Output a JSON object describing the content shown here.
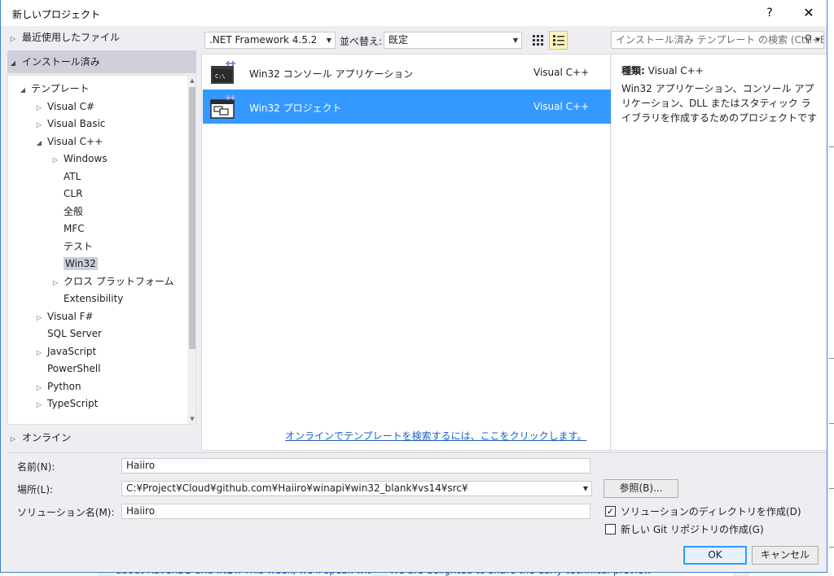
{
  "dialog": {
    "title": "新しいプロジェクト",
    "help": "?",
    "close": "✕"
  },
  "nav": {
    "recent": "最近使用したファイル",
    "installed": "インストール済み",
    "online": "オンライン",
    "tree": [
      {
        "label": "テンプレート",
        "indent": 0,
        "arrow": "◢"
      },
      {
        "label": "Visual C#",
        "indent": 1,
        "arrow": "▷"
      },
      {
        "label": "Visual Basic",
        "indent": 1,
        "arrow": "▷"
      },
      {
        "label": "Visual C++",
        "indent": 1,
        "arrow": "◢"
      },
      {
        "label": "Windows",
        "indent": 2,
        "arrow": "▷"
      },
      {
        "label": "ATL",
        "indent": 2,
        "arrow": ""
      },
      {
        "label": "CLR",
        "indent": 2,
        "arrow": ""
      },
      {
        "label": "全般",
        "indent": 2,
        "arrow": ""
      },
      {
        "label": "MFC",
        "indent": 2,
        "arrow": ""
      },
      {
        "label": "テスト",
        "indent": 2,
        "arrow": ""
      },
      {
        "label": "Win32",
        "indent": 2,
        "arrow": "",
        "selected": true
      },
      {
        "label": "クロス プラットフォーム",
        "indent": 2,
        "arrow": "▷"
      },
      {
        "label": "Extensibility",
        "indent": 2,
        "arrow": ""
      },
      {
        "label": "Visual F#",
        "indent": 1,
        "arrow": "▷"
      },
      {
        "label": "SQL Server",
        "indent": 1,
        "arrow": ""
      },
      {
        "label": "JavaScript",
        "indent": 1,
        "arrow": "▷"
      },
      {
        "label": "PowerShell",
        "indent": 1,
        "arrow": ""
      },
      {
        "label": "Python",
        "indent": 1,
        "arrow": "▷"
      },
      {
        "label": "TypeScript",
        "indent": 1,
        "arrow": "▷"
      }
    ]
  },
  "toolbar": {
    "framework": ".NET Framework 4.5.2",
    "sort_label": "並べ替え:",
    "sort_value": "既定",
    "search_placeholder": "インストール済み テンプレート の検索 (Ctrl+E"
  },
  "templates": [
    {
      "name": "Win32 コンソール アプリケーション",
      "lang": "Visual C++",
      "icon": "console-app-icon",
      "selected": false
    },
    {
      "name": "Win32 プロジェクト",
      "lang": "Visual C++",
      "icon": "win32-project-icon",
      "selected": true
    }
  ],
  "online_link": "オンラインでテンプレートを検索するには、ここをクリックします。",
  "details": {
    "type_label": "種類:",
    "type_value": "Visual C++",
    "description": "Win32 アプリケーション、コンソール アプリケーション、DLL またはスタティック ライブラリを作成するためのプロジェクトです"
  },
  "form": {
    "name_label": "名前(N):",
    "name_value": "Haiiro",
    "location_label": "場所(L):",
    "location_value": "C:¥Project¥Cloud¥github.com¥Haiiro¥winapi¥win32_blank¥vs14¥src¥",
    "solution_label": "ソリューション名(M):",
    "solution_value": "Haiiro",
    "browse_button": "参照(B)...",
    "create_dir_label": "ソリューションのディレクトリを作成(D)",
    "create_dir_checked": true,
    "git_label": "新しい Git リポジトリの作成(G)",
    "git_checked": false,
    "ok_button": "OK",
    "cancel_button": "キャンセル"
  },
  "background": {
    "left_text": "about RavenDB and .NET. This week, we'll speak with",
    "right_text": "We are delighted to share the early technical preview"
  }
}
